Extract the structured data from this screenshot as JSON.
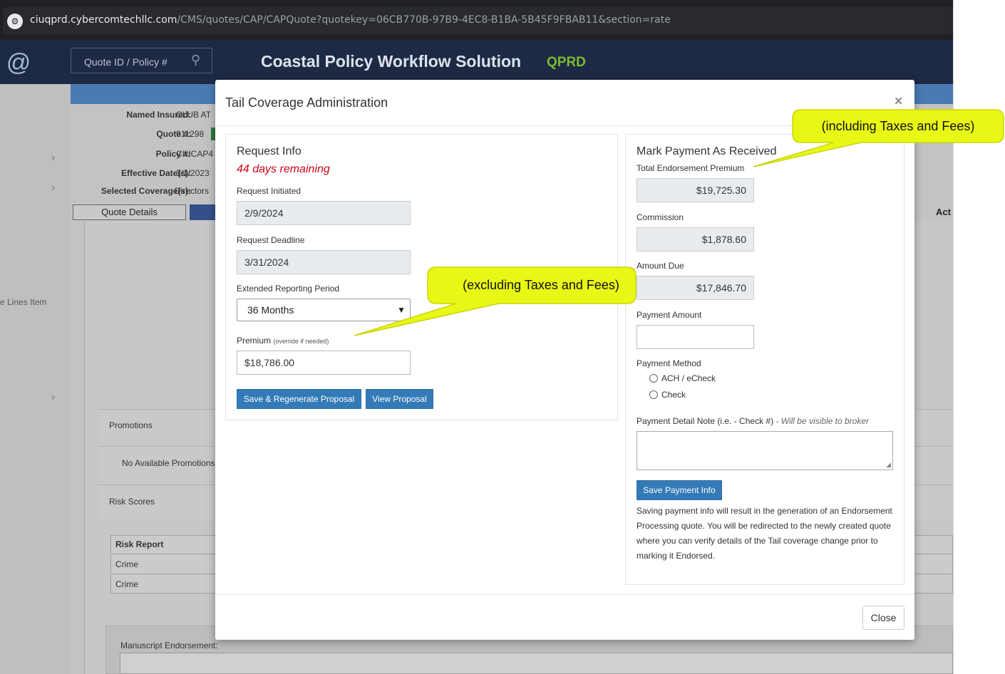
{
  "browser": {
    "url_host": "ciuqprd.cybercomtechllc.com",
    "url_path": "/CMS/quotes/CAP/CAPQuote?quotekey=06CB770B-97B9-4EC8-B1BA-5B45F9FBAB11&section=rate"
  },
  "app": {
    "search_placeholder": "Quote ID / Policy #",
    "title": "Coastal Policy Workflow Solution",
    "environment": "QPRD",
    "left_rail_item": "e Lines Item",
    "summary": {
      "named_insured_label": "Named Insured:",
      "named_insured_value": "CLUB AT",
      "quote_no_label": "Quote #:",
      "quote_no_value": "911298",
      "policy_label": "Policy #:",
      "policy_value": "CIUCAP4",
      "effective_label": "Effective Date(s):",
      "effective_value": "3/1/2023",
      "coverage_label": "Selected Coverage(s):",
      "coverage_value": "Directors"
    },
    "tabs": {
      "quote_details": "Quote Details",
      "actions_partial": "Act"
    },
    "promotions_label": "Promotions",
    "no_promotions": "No Available Promotions",
    "risk_scores_label": "Risk Scores",
    "risk_table": {
      "header": "Risk Report",
      "rows": [
        "Crime",
        "Crime"
      ]
    },
    "manuscript_label": "Manuscript Endorsement:"
  },
  "modal": {
    "title": "Tail Coverage Administration",
    "close_symbol": "×",
    "request_info": {
      "title": "Request Info",
      "days_remaining": "44 days remaining",
      "initiated_label": "Request Initiated",
      "initiated_value": "2/9/2024",
      "deadline_label": "Request Deadline",
      "deadline_value": "3/31/2024",
      "period_label": "Extended Reporting Period",
      "period_value": "36 Months",
      "premium_label": "Premium",
      "premium_hint": "(override if needed)",
      "premium_value": "$18,786.00",
      "save_regen_label": "Save & Regenerate Proposal",
      "view_proposal_label": "View Proposal"
    },
    "payment": {
      "title": "Mark Payment As Received",
      "total_label": "Total Endorsement Premium",
      "total_value": "$19,725.30",
      "commission_label": "Commission",
      "commission_value": "$1,878.60",
      "amount_due_label": "Amount Due",
      "amount_due_value": "$17,846.70",
      "payment_amount_label": "Payment Amount",
      "payment_amount_value": "",
      "method_label": "Payment Method",
      "method_options": [
        "ACH / eCheck",
        "Check"
      ],
      "note_label": "Payment Detail Note (i.e. - Check #)",
      "note_hint": "- Will be visible to broker",
      "note_value": "",
      "save_label": "Save Payment Info",
      "help_text": "Saving payment info will result in the generation of an Endorsement Processing quote. You will be redirected to the newly created quote where you can verify details of the Tail coverage change prior to marking it Endorsed."
    },
    "footer_close_label": "Close"
  },
  "callouts": {
    "including": "(including Taxes and Fees)",
    "excluding": "(excluding Taxes and Fees)",
    "fill_color": "#e8f714"
  },
  "icons": {
    "site_info": "site-info-icon",
    "search": "search-icon",
    "logo": "nautilus-logo-icon"
  }
}
